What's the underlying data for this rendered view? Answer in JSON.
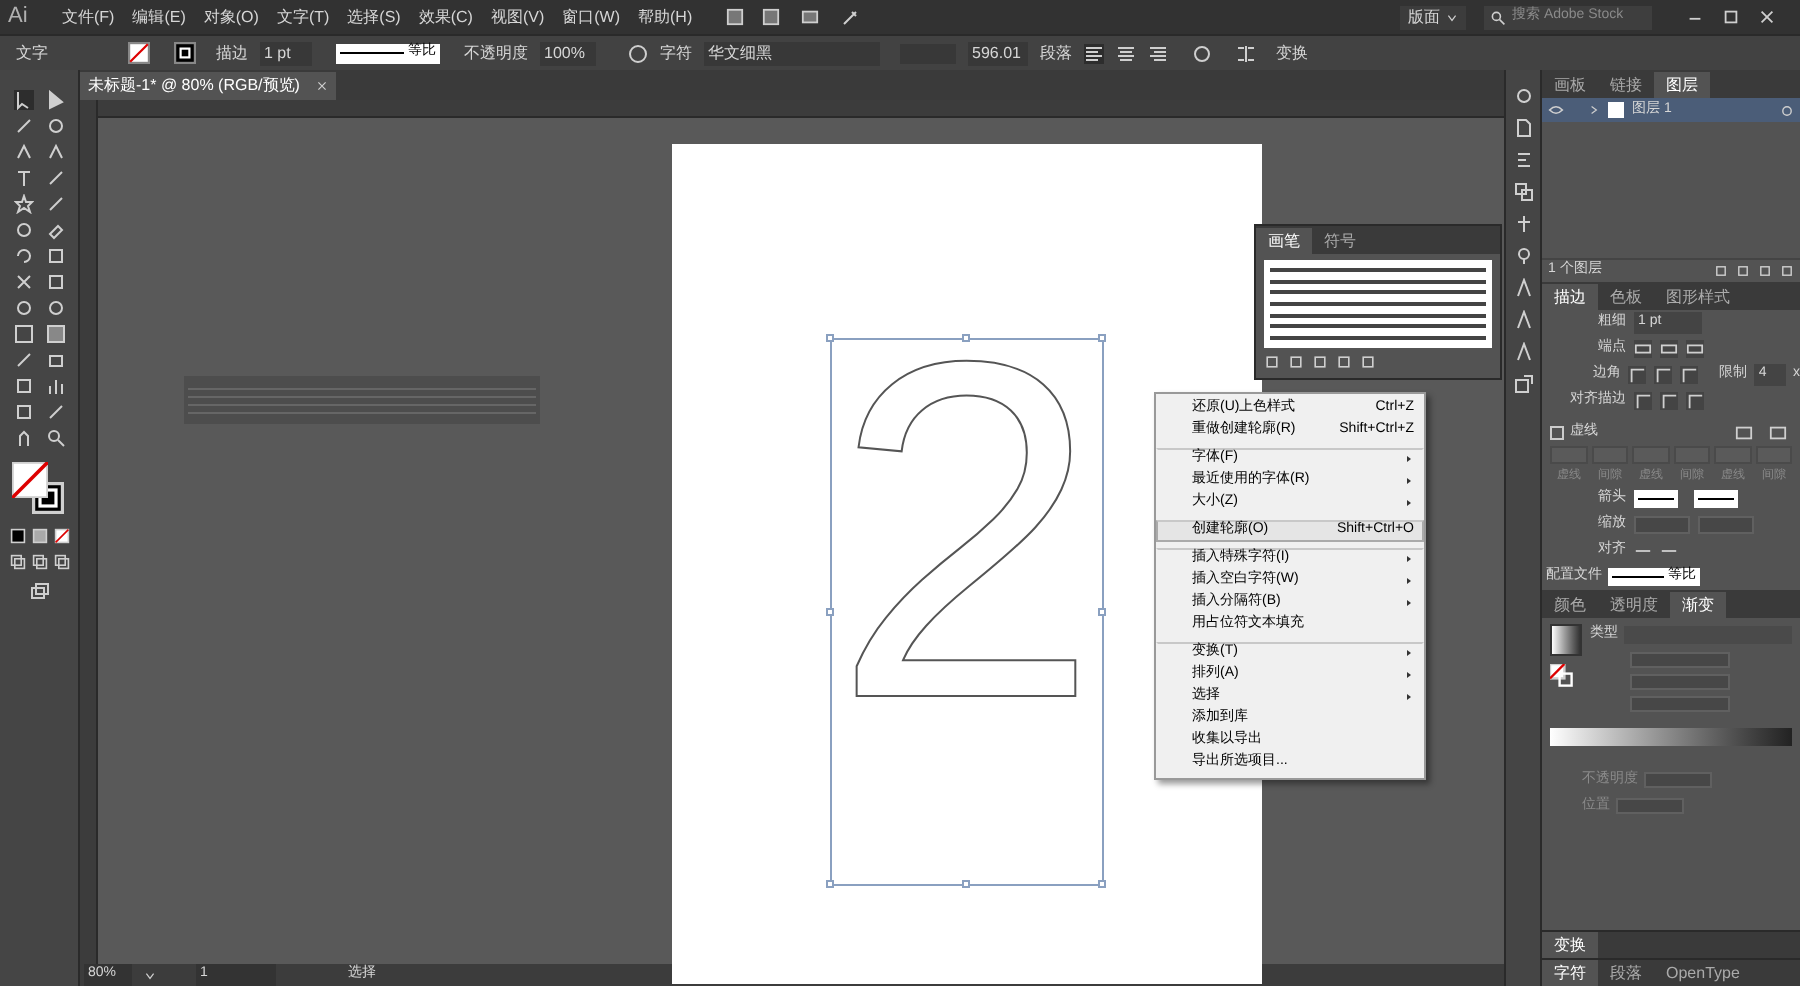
{
  "app": {
    "logo": "Ai"
  },
  "menu": [
    "文件(F)",
    "编辑(E)",
    "对象(O)",
    "文字(T)",
    "选择(S)",
    "效果(C)",
    "视图(V)",
    "窗口(W)",
    "帮助(H)"
  ],
  "workspace": "版面",
  "search": {
    "placeholder": "搜索 Adobe Stock"
  },
  "control_bar": {
    "type_label": "文字",
    "stroke_label": "描边",
    "stroke_weight": "1 pt",
    "profile": "等比",
    "opacity_label": "不透明度",
    "opacity": "100%",
    "character_label": "字符",
    "font": "华文细黑",
    "size": "596.01",
    "paragraph_label": "段落",
    "transform_label": "变换"
  },
  "document_tabs": [
    {
      "label": "未标题-1* @ 80% (RGB/预览)",
      "selected": true
    }
  ],
  "artwork": {
    "text": "2"
  },
  "brushes_panel": {
    "tabs": [
      {
        "label": "画笔",
        "selected": true
      },
      {
        "label": "符号",
        "selected": false
      }
    ]
  },
  "context_menu": [
    {
      "label": "还原(U)上色样式",
      "shortcut": "Ctrl+Z",
      "submenu": false,
      "selected": false,
      "separator_before": false
    },
    {
      "label": "重做创建轮廓(R)",
      "shortcut": "Shift+Ctrl+Z",
      "submenu": false,
      "selected": false,
      "separator_before": false
    },
    {
      "label": "字体(F)",
      "submenu": true,
      "selected": false,
      "separator_before": true
    },
    {
      "label": "最近使用的字体(R)",
      "submenu": true,
      "selected": false,
      "separator_before": false
    },
    {
      "label": "大小(Z)",
      "submenu": true,
      "selected": false,
      "separator_before": false
    },
    {
      "label": "创建轮廓(O)",
      "shortcut": "Shift+Ctrl+O",
      "submenu": false,
      "selected": true,
      "separator_before": true
    },
    {
      "label": "插入特殊字符(I)",
      "submenu": true,
      "selected": false,
      "separator_before": true
    },
    {
      "label": "插入空白字符(W)",
      "submenu": true,
      "selected": false,
      "separator_before": false
    },
    {
      "label": "插入分隔符(B)",
      "submenu": true,
      "selected": false,
      "separator_before": false
    },
    {
      "label": "用占位符文本填充",
      "submenu": false,
      "selected": false,
      "separator_before": false
    },
    {
      "label": "变换(T)",
      "submenu": true,
      "selected": false,
      "separator_before": true
    },
    {
      "label": "排列(A)",
      "submenu": true,
      "selected": false,
      "separator_before": false
    },
    {
      "label": "选择",
      "submenu": true,
      "selected": false,
      "separator_before": false
    },
    {
      "label": "添加到库",
      "submenu": false,
      "selected": false,
      "separator_before": false
    },
    {
      "label": "收集以导出",
      "submenu": false,
      "selected": false,
      "separator_before": false
    },
    {
      "label": "导出所选项目...",
      "submenu": false,
      "selected": false,
      "separator_before": false
    }
  ],
  "layers_panel": {
    "tabs": [
      {
        "label": "画板",
        "selected": false
      },
      {
        "label": "链接",
        "selected": false
      },
      {
        "label": "图层",
        "selected": true
      }
    ],
    "layers": [
      {
        "name": "图层 1",
        "selected": true
      }
    ],
    "count": "1 个图层"
  },
  "stroke_panel": {
    "tabs": [
      {
        "label": "描边",
        "selected": true
      },
      {
        "label": "色板",
        "selected": false
      },
      {
        "label": "图形样式",
        "selected": false
      }
    ],
    "weight_label": "粗细",
    "weight": "1 pt",
    "cap_label": "端点",
    "corner_label": "边角",
    "limit_label": "限制",
    "limit": "4",
    "limit_unit": "x",
    "align_label": "对齐描边",
    "dashed": {
      "label": "虚线",
      "checked": false
    },
    "dash_labels": [
      "虚线",
      "间隙",
      "虚线",
      "间隙",
      "虚线",
      "间隙"
    ],
    "arrowheads_label": "箭头",
    "scale_label": "缩放",
    "align2_label": "对齐",
    "profile_label": "配置文件",
    "profile": "等比"
  },
  "gradient_panel": {
    "tabs": [
      {
        "label": "颜色",
        "selected": false
      },
      {
        "label": "透明度",
        "selected": false
      },
      {
        "label": "渐变",
        "selected": true
      }
    ],
    "type_label": "类型",
    "opacity_label": "不透明度",
    "location_label": "位置"
  },
  "collapsed_panels": [
    {
      "tabs": [
        {
          "label": "变换",
          "selected": true
        }
      ]
    },
    {
      "tabs": [
        {
          "label": "字符",
          "selected": true
        },
        {
          "label": "段落",
          "selected": false
        },
        {
          "label": "OpenType",
          "selected": false
        }
      ]
    }
  ],
  "status_bar": {
    "zoom": "80%",
    "artboard": "1",
    "tool": "选择"
  }
}
